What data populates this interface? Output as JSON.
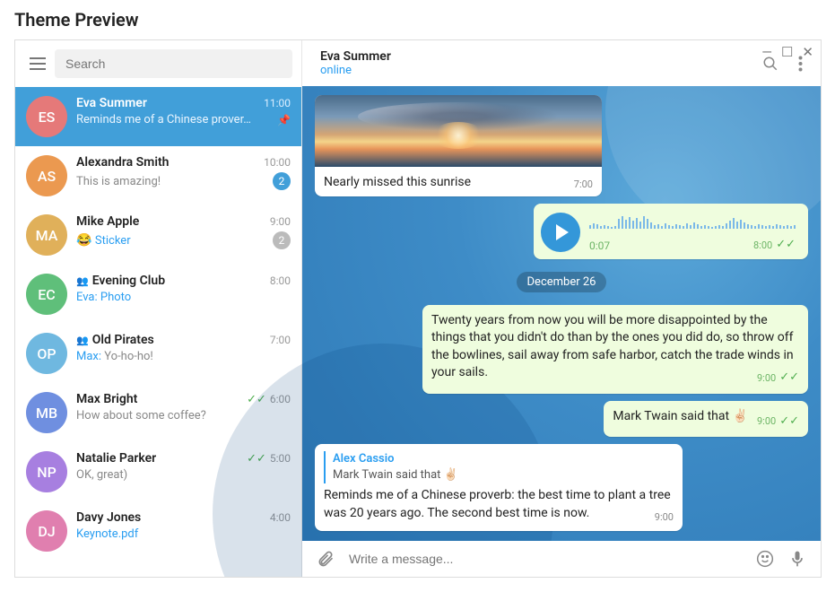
{
  "page_title": "Theme Preview",
  "search": {
    "placeholder": "Search"
  },
  "chats": [
    {
      "initials": "ES",
      "name": "Eva Summer",
      "time": "11:00",
      "preview": "Reminds me of a Chinese prover…",
      "avatar_color": "#e57979",
      "active": true,
      "pinned": true
    },
    {
      "initials": "AS",
      "name": "Alexandra Smith",
      "time": "10:00",
      "preview": "This is amazing!",
      "avatar_color": "#eb9950",
      "badge": "2",
      "badge_muted": false
    },
    {
      "initials": "MA",
      "name": "Mike Apple",
      "time": "9:00",
      "preview_emoji": "😂",
      "preview_link": "Sticker",
      "avatar_color": "#e0b05a",
      "badge": "2",
      "badge_muted": true
    },
    {
      "initials": "EC",
      "name": "Evening Club",
      "time": "8:00",
      "preview_sender": "Eva:",
      "preview_link_only": "Photo",
      "avatar_color": "#5fbf7a",
      "group": true
    },
    {
      "initials": "OP",
      "name": "Old Pirates",
      "time": "7:00",
      "preview_sender": "Max:",
      "preview_rest": " Yo-ho-ho!",
      "avatar_color": "#6fb8e0",
      "group": true
    },
    {
      "initials": "MB",
      "name": "Max Bright",
      "time": "6:00",
      "preview": "How about some coffee?",
      "avatar_color": "#6f8fe0",
      "read": true
    },
    {
      "initials": "NP",
      "name": "Natalie Parker",
      "time": "5:00",
      "preview": "OK, great)",
      "avatar_color": "#a77fe0",
      "read": true
    },
    {
      "initials": "DJ",
      "name": "Davy Jones",
      "time": "4:00",
      "preview_link_only": "Keynote.pdf",
      "avatar_color": "#e07faf"
    }
  ],
  "header": {
    "name": "Eva Summer",
    "status": "online"
  },
  "messages": {
    "photo_caption": "Nearly missed this sunrise",
    "photo_time": "7:00",
    "voice_duration": "0:07",
    "voice_time": "8:00",
    "date_separator": "December 26",
    "quote_text": "Twenty years from now you will be more disappointed by the things that you didn't do than by the ones you did do, so throw off the bowlines, sail away from safe harbor, catch the trade winds in your sails.",
    "quote_time": "9:00",
    "twain_text": "Mark Twain said that ",
    "twain_time": "9:00",
    "reply_name": "Alex Cassio",
    "reply_quoted": "Mark Twain said that ",
    "reply_body": "Reminds me of a Chinese proverb: the best time to plant a tree was 20 years ago. The second best time is now.",
    "reply_time": "9:00"
  },
  "composer": {
    "placeholder": "Write a message..."
  }
}
